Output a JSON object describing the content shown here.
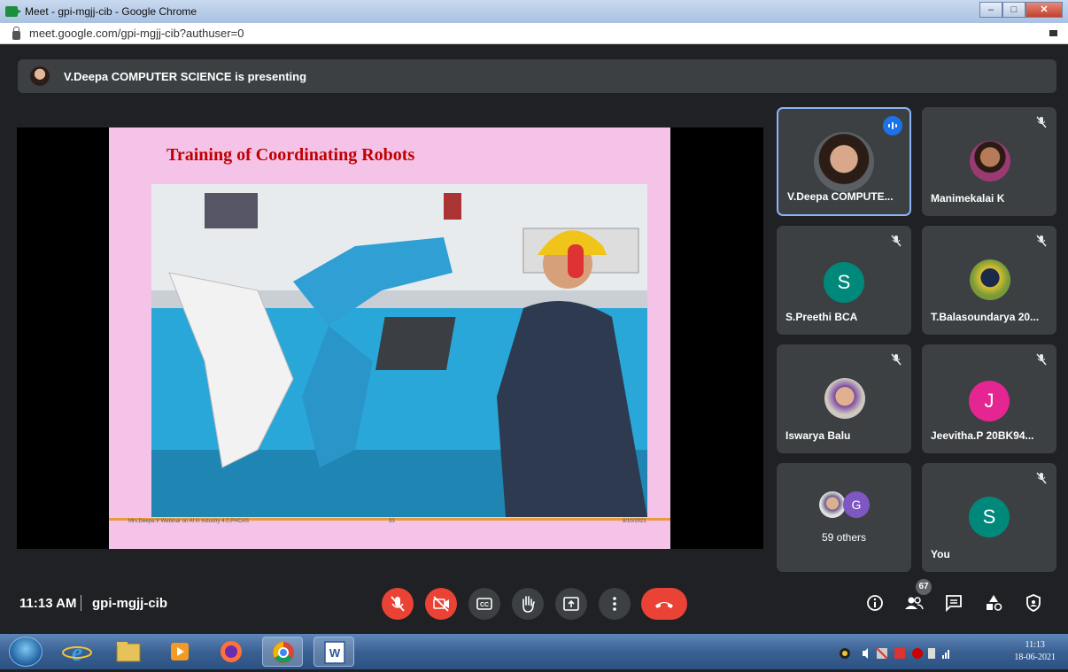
{
  "window": {
    "title": "Meet - gpi-mgjj-cib - Google Chrome",
    "url": "meet.google.com/gpi-mgjj-cib?authuser=0"
  },
  "banner": {
    "text": "V.Deepa COMPUTER SCIENCE is presenting"
  },
  "slide": {
    "title": "Training of Coordinating Robots",
    "footer_left": "Mrs.Deepa.V Webinar on AI in Industry 4.0,PHCAS",
    "footer_page": "33",
    "footer_date": "8/10/2021"
  },
  "participants": [
    {
      "name": "V.Deepa COMPUTE...",
      "avatar": "photo",
      "speaking": true
    },
    {
      "name": "Manimekalai K",
      "avatar": "photo",
      "muted": true
    },
    {
      "name": "S.Preethi BCA",
      "avatar_letter": "S",
      "avatar_color": "#00897b",
      "muted": true
    },
    {
      "name": "T.Balasoundarya 20...",
      "avatar": "photo",
      "muted": true
    },
    {
      "name": "Iswarya Balu",
      "avatar": "photo",
      "muted": true
    },
    {
      "name": "Jeevitha.P 20BK94...",
      "avatar_letter": "J",
      "avatar_color": "#e52592",
      "muted": true
    },
    {
      "name": "59 others",
      "avatar_letter": "G",
      "avatar_color": "#7e57c2"
    },
    {
      "name": "You",
      "avatar_letter": "S",
      "avatar_color": "#00897b",
      "muted": true
    }
  ],
  "toolbar": {
    "time": "11:13 AM",
    "separator": "|",
    "meeting_code": "gpi-mgjj-cib",
    "people_count": "67",
    "controls": [
      "mic-off-icon",
      "camera-off-icon",
      "captions-icon",
      "raise-hand-icon",
      "present-icon",
      "more-options-icon",
      "end-call-icon"
    ],
    "right_controls": [
      "info-icon",
      "people-icon",
      "chat-icon",
      "activities-icon",
      "host-controls-icon"
    ]
  },
  "taskbar": {
    "apps": [
      "start-orb",
      "internet-explorer",
      "file-explorer",
      "media-player",
      "firefox",
      "chrome",
      "word"
    ],
    "clock_time": "11:13",
    "clock_date": "18-06-2021"
  },
  "colors": {
    "background": "#202124",
    "tile": "#3c4043",
    "danger": "#ea4335",
    "accent": "#8ab4f8"
  }
}
